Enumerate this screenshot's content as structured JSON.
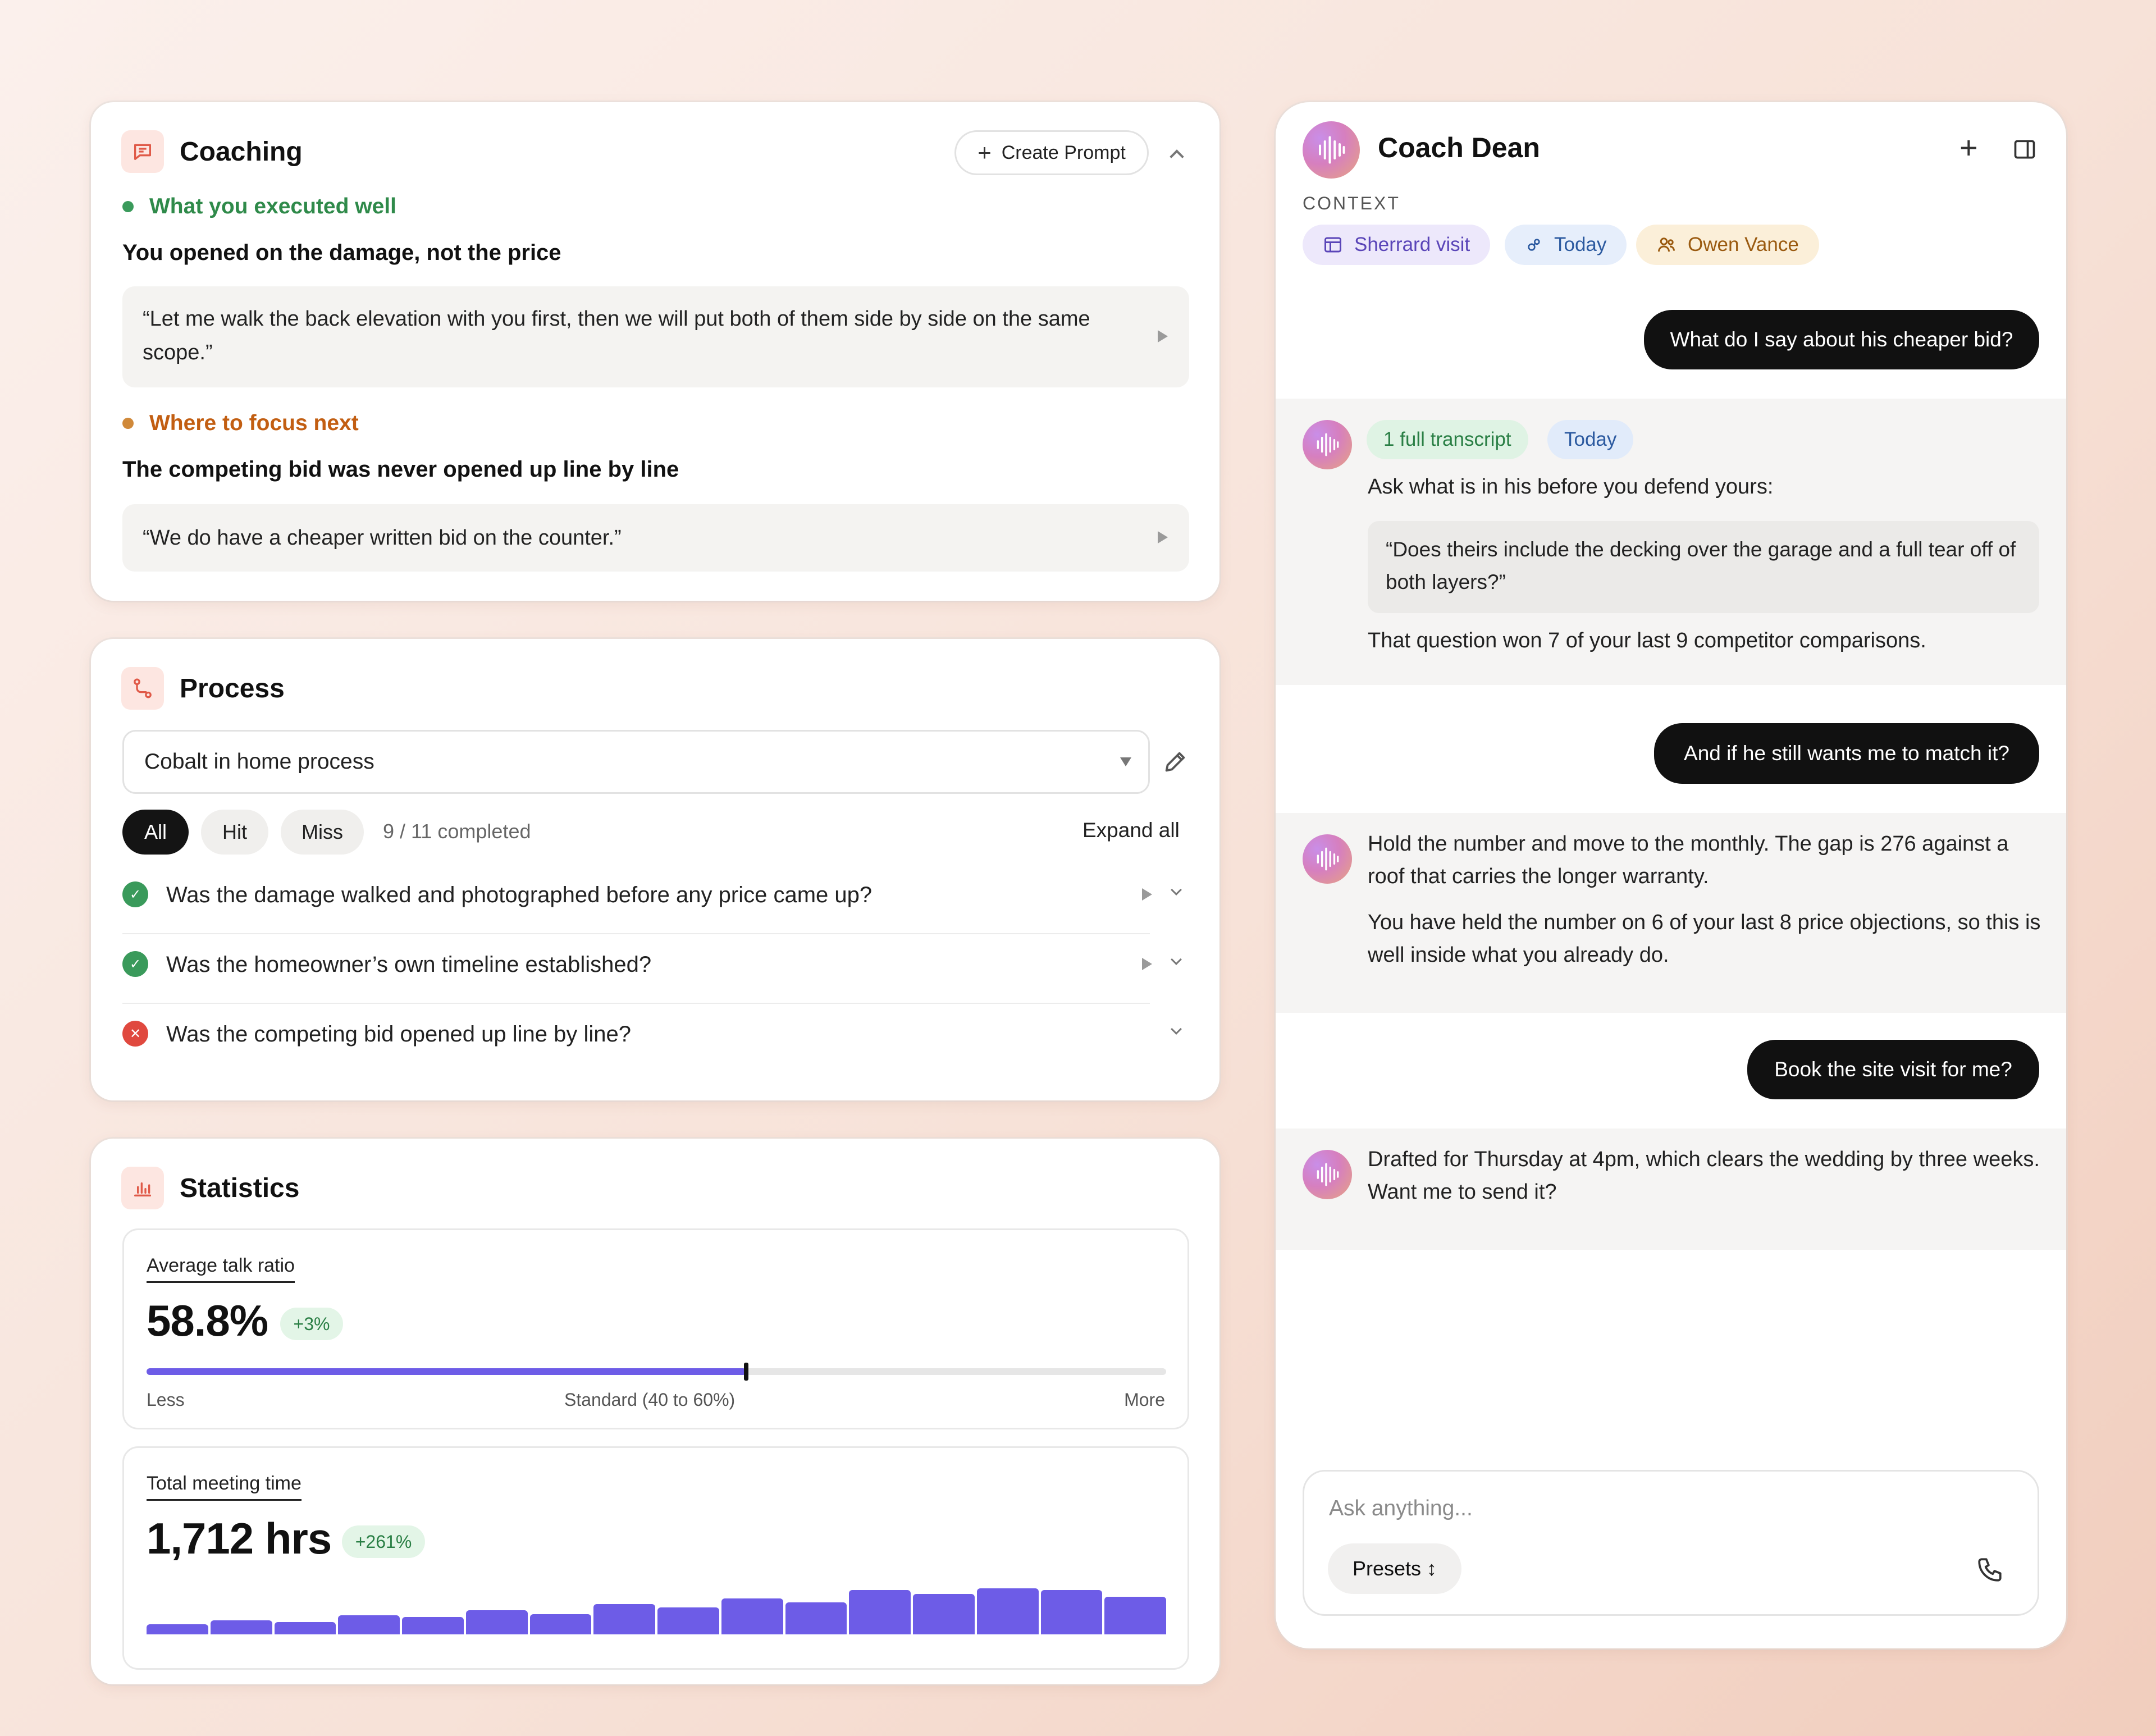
{
  "coaching": {
    "title": "Coaching",
    "create_prompt": "Create Prompt",
    "well_label": "What you executed well",
    "well_headline": "You opened on the damage, not the price",
    "well_quote": "“Let me walk the back elevation with you first, then we will put both of them side by side on the same scope.”",
    "focus_label": "Where to focus next",
    "focus_headline": "The competing bid was never opened up line by line",
    "focus_quote": "“We do have a cheaper written bid on the counter.”"
  },
  "process": {
    "title": "Process",
    "selected": "Cobalt in home process",
    "filters": [
      "All",
      "Hit",
      "Miss"
    ],
    "completed": "9 / 11 completed",
    "expand_all": "Expand all",
    "items": [
      {
        "text": "Was the damage walked and photographed before any price came up?",
        "status": "hit"
      },
      {
        "text": "Was the homeowner’s own timeline established?",
        "status": "hit"
      },
      {
        "text": "Was the competing bid opened up line by line?",
        "status": "miss"
      }
    ]
  },
  "statistics": {
    "title": "Statistics",
    "talk_ratio": {
      "label": "Average talk ratio",
      "value": "58.8%",
      "delta": "+3%",
      "fraction": 0.588,
      "less": "Less",
      "standard": "Standard (40 to 60%)",
      "more": "More"
    },
    "meeting_time": {
      "label": "Total meeting time",
      "value": "1,712 hrs",
      "delta": "+261%",
      "bars": [
        0.22,
        0.31,
        0.27,
        0.42,
        0.38,
        0.52,
        0.44,
        0.66,
        0.58,
        0.78,
        0.7,
        0.96,
        0.88,
        1.0,
        0.96,
        0.82
      ]
    }
  },
  "coach": {
    "title": "Coach Dean",
    "context_label": "CONTEXT",
    "context_tags": [
      {
        "label": "Sherrard visit",
        "icon": "layout-icon"
      },
      {
        "label": "Today",
        "icon": "link-icon"
      },
      {
        "label": "Owen Vance",
        "icon": "users-icon"
      }
    ],
    "messages": {
      "user1": "What do I say about his cheaper bid?",
      "ai1_tag_transcript": "1 full transcript",
      "ai1_tag_today": "Today",
      "ai1_intro": "Ask what is in his before you defend yours:",
      "ai1_quote": "“Does theirs include the decking over the garage and a full tear off of both layers?”",
      "ai1_outro": "That question won 7 of your last 9 competitor comparisons.",
      "user2": "And if he still wants me to match it?",
      "ai2_p1": "Hold the number and move to the monthly. The gap is 276 against a roof that carries the longer warranty.",
      "ai2_p2": "You have held the number on 6 of your last 8 price objections, so this is well inside what you already do.",
      "user3": "Book the site visit for me?",
      "ai3": "Drafted for Thursday at 4pm, which clears the wedding by three weeks. Want me to send it?"
    },
    "input_placeholder": "Ask anything...",
    "presets": "Presets ↕"
  },
  "colors": {
    "accent_purple": "#6d5ce7",
    "hit_green": "#3a9a5b",
    "miss_red": "#e0493f",
    "well_green": "#2f8a4a",
    "focus_orange": "#c25e12"
  }
}
